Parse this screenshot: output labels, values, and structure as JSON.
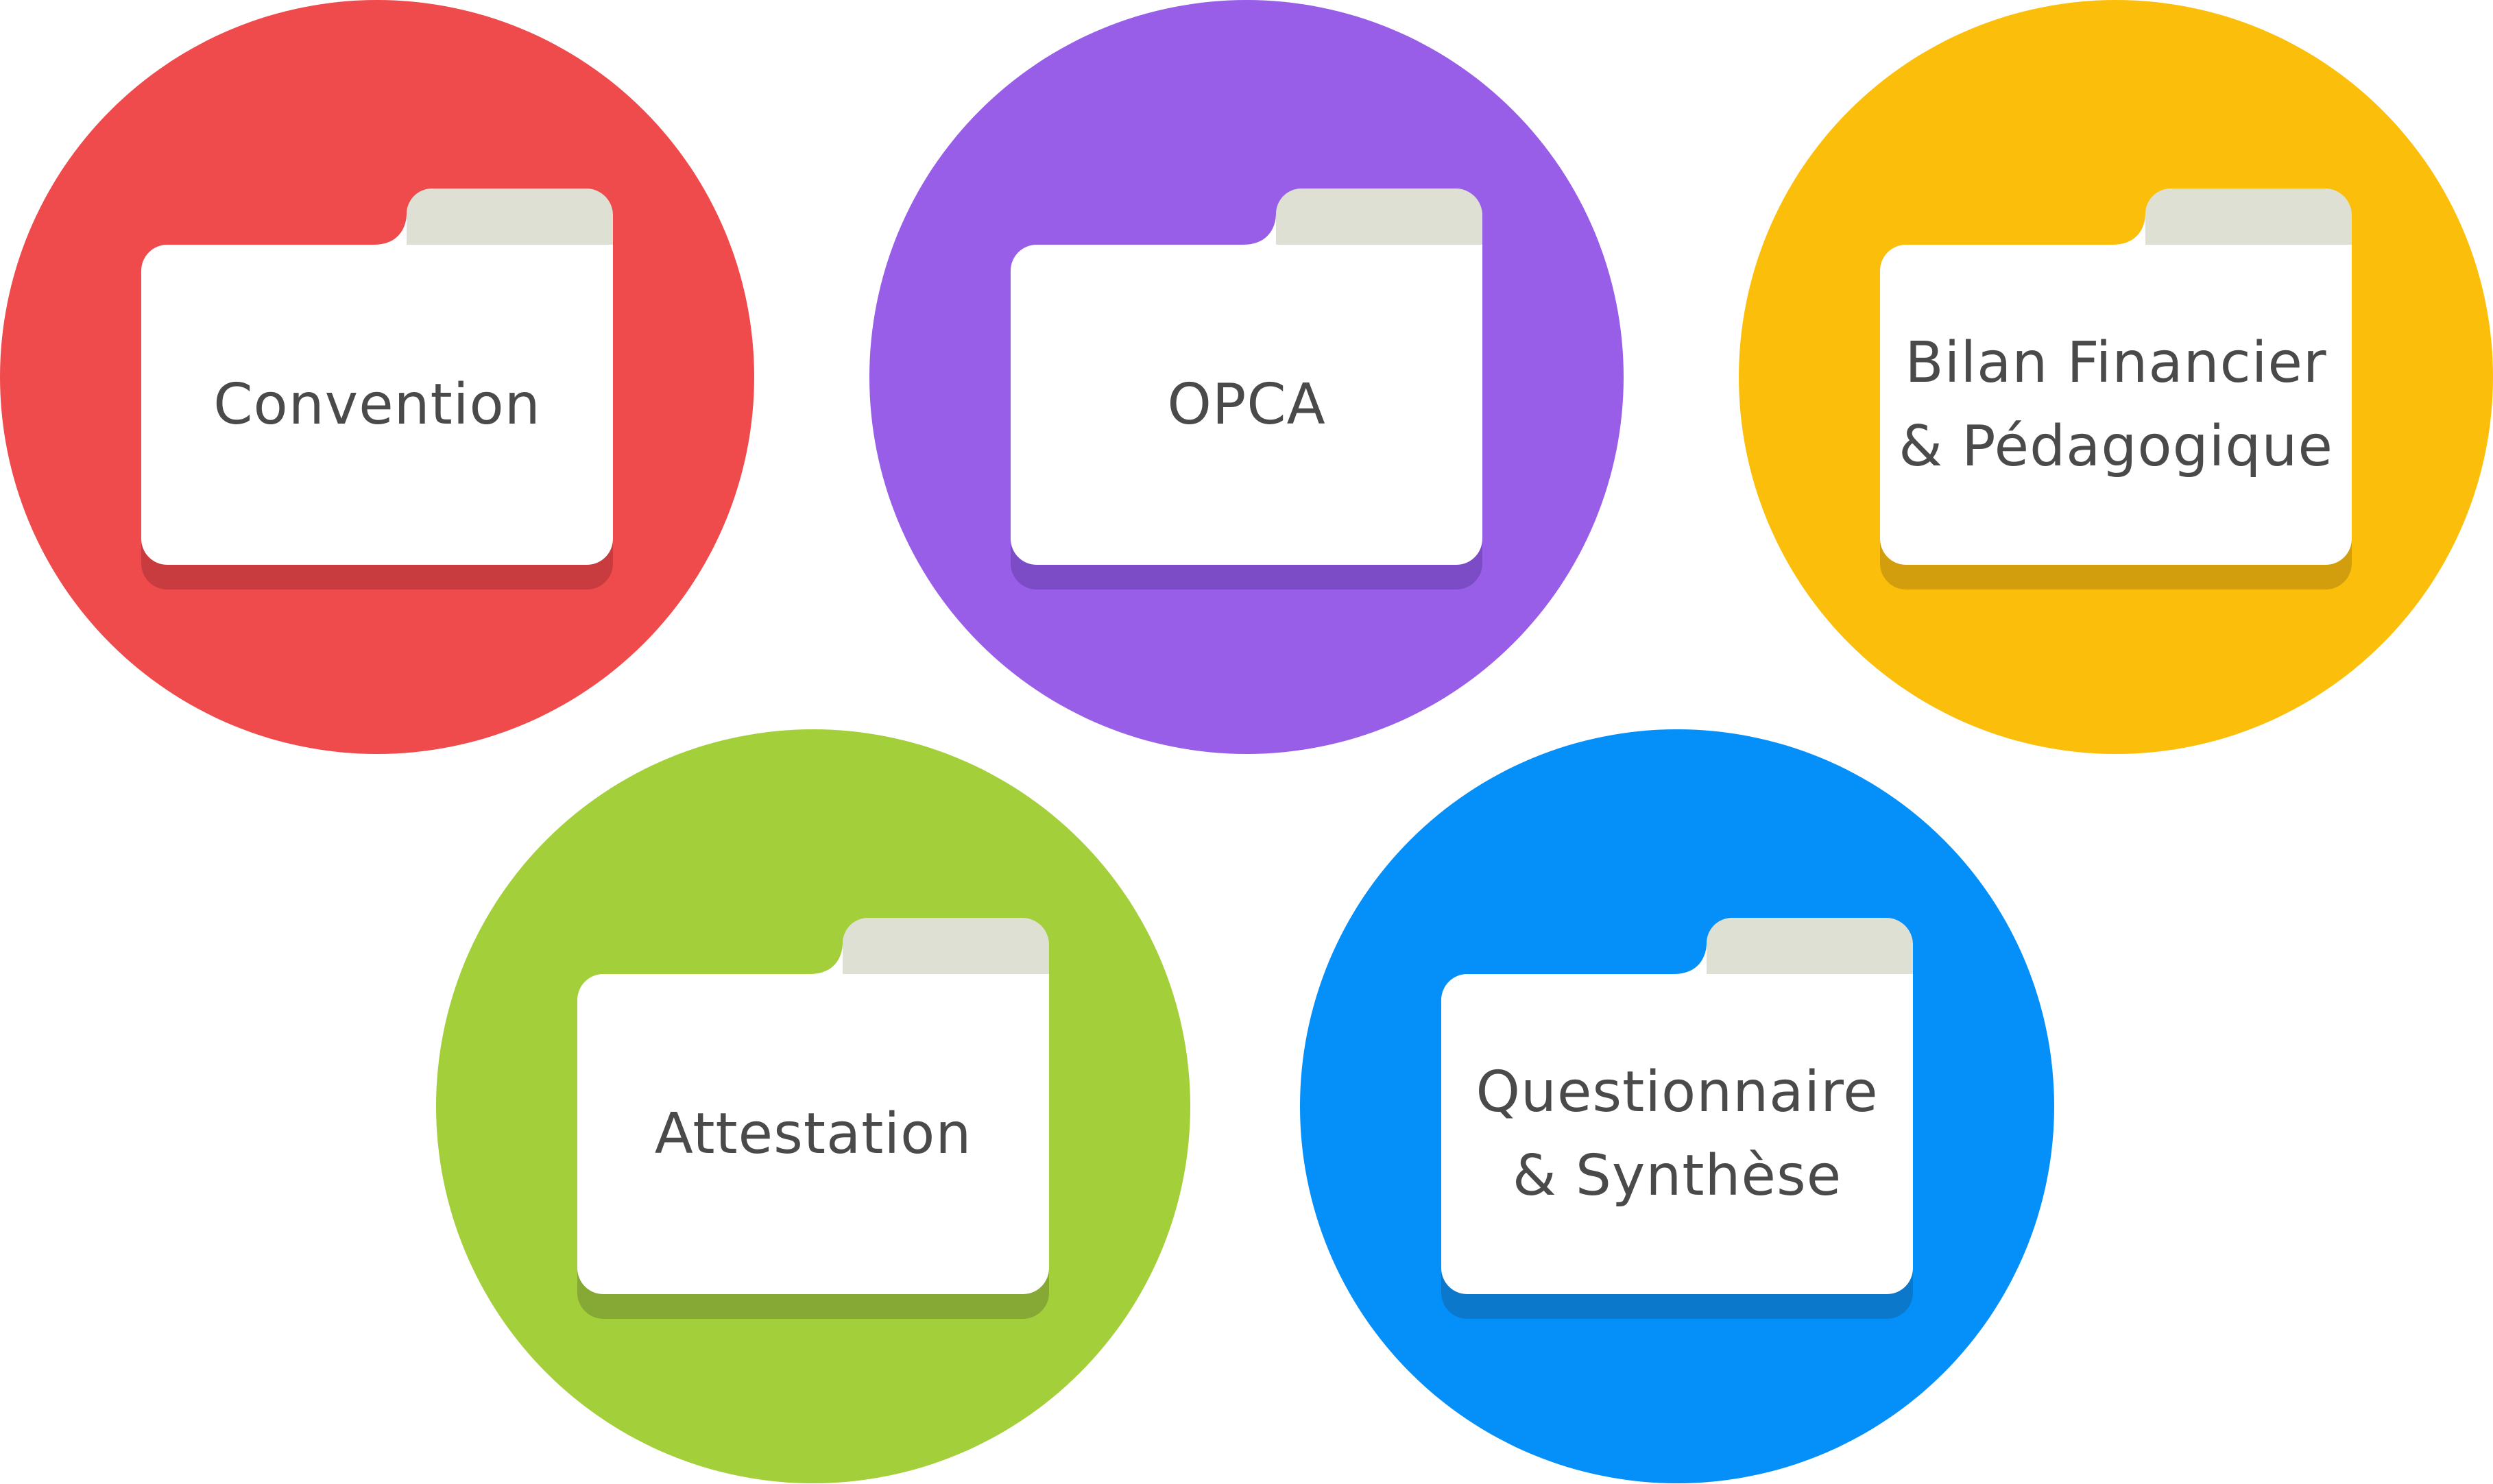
{
  "folders": [
    {
      "id": "convention",
      "lines": [
        "Convention"
      ],
      "color": "#ef4a4c",
      "shadow": "#c83b3f",
      "icon": "folder-icon"
    },
    {
      "id": "opca",
      "lines": [
        "OPCA"
      ],
      "color": "#985ee8",
      "shadow": "#7c4bc6",
      "icon": "folder-icon"
    },
    {
      "id": "bilan",
      "lines": [
        "Bilan Financier",
        "& Pédagogique"
      ],
      "color": "#fbbf0b",
      "shadow": "#d29e0d",
      "icon": "folder-icon"
    },
    {
      "id": "attestation",
      "lines": [
        "Attestation"
      ],
      "color": "#a3cf3a",
      "shadow": "#86a834",
      "icon": "folder-icon"
    },
    {
      "id": "questionnaire",
      "lines": [
        "Questionnaire",
        "& Synthèse"
      ],
      "color": "#058ff9",
      "shadow": "#0b78cc",
      "icon": "folder-icon"
    }
  ],
  "folder_tab_color": "#dfe0d4",
  "folder_body_color": "#ffffff"
}
